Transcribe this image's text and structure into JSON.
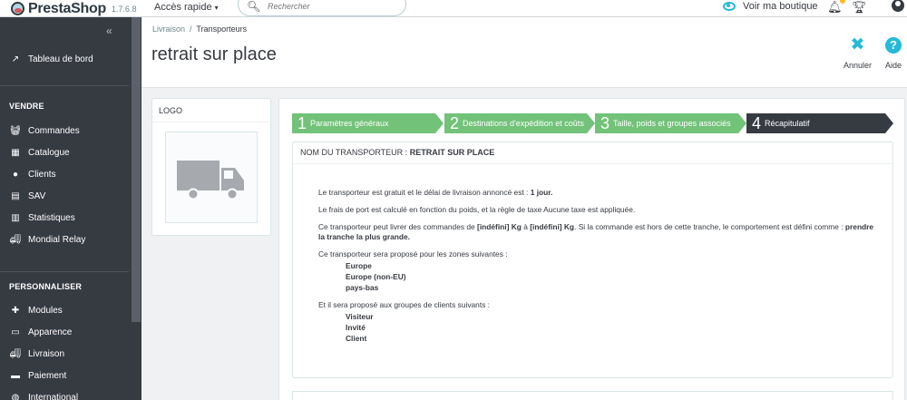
{
  "header": {
    "brand": "PrestaShop",
    "version": "1.7.6.8",
    "quick_access": "Accès rapide",
    "search_placeholder": "Rechercher",
    "view_shop": "Voir ma boutique"
  },
  "sidebar": {
    "dashboard": "Tableau de bord",
    "sections": [
      {
        "title": "VENDRE",
        "items": [
          "Commandes",
          "Catalogue",
          "Clients",
          "SAV",
          "Statistiques",
          "Mondial Relay"
        ]
      },
      {
        "title": "PERSONNALISER",
        "items": [
          "Modules",
          "Apparence",
          "Livraison",
          "Paiement",
          "International"
        ]
      }
    ]
  },
  "breadcrumb": {
    "parent": "Livraison",
    "separator": "/",
    "current": "Transporteurs"
  },
  "page_title": "retrait sur place",
  "toolbar": {
    "cancel_label": "Annuler",
    "help_label": "Aide"
  },
  "logo_panel": {
    "title": "LOGO"
  },
  "steps": [
    {
      "num": "1",
      "label": "Paramètres généraux"
    },
    {
      "num": "2",
      "label": "Destinations d'expédition et coûts"
    },
    {
      "num": "3",
      "label": "Taille, poids et groupes associés"
    },
    {
      "num": "4",
      "label": "Récapitulatif"
    }
  ],
  "summary": {
    "head_label": "NOM DU TRANSPORTEUR :",
    "carrier_name": "RETRAIT SUR PLACE",
    "p1_a": "Le transporteur est gratuit et le délai de livraison annoncé est :",
    "p1_b": "1 jour.",
    "p2": "Le frais de port est calculé en fonction du poids, et la règle de taxe Aucune taxe est appliquée.",
    "p3_a": "Ce transporteur peut livrer des commandes de",
    "p3_b": "[indéfini] Kg",
    "p3_c": "à",
    "p3_d": "[indéfini] Kg",
    "p3_e": ". Si la commande est hors de cette tranche, le comportement est défini comme :",
    "p3_f": "prendre la tranche la plus grande.",
    "zones_intro": "Ce transporteur sera proposé pour les zones suivantes :",
    "zones": [
      "Europe",
      "Europe (non-EU)",
      "pays-bas"
    ],
    "groups_intro": "Et il sera proposé aux groupes de clients suivants :",
    "groups": [
      "Visiteur",
      "Invité",
      "Client"
    ]
  },
  "colors": {
    "sidebar_bg": "#363a41",
    "accent": "#25b9d7",
    "step_done": "#72c279",
    "step_current": "#363a41"
  }
}
